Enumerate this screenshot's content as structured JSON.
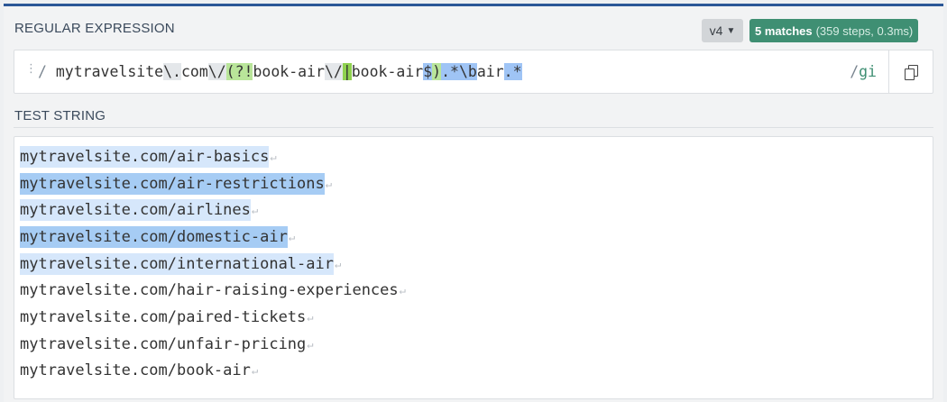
{
  "regex_section": {
    "title": "REGULAR EXPRESSION",
    "flavor": "v4",
    "match_count": "5 matches",
    "match_details": "(359 steps, 0.3ms)",
    "delimiter_open": "/",
    "tokens": [
      {
        "text": " mytravelsite",
        "kind": "plain"
      },
      {
        "text": "\\.",
        "kind": "esc"
      },
      {
        "text": "com",
        "kind": "plain"
      },
      {
        "text": "\\/",
        "kind": "esc"
      },
      {
        "text": "(?!",
        "kind": "grp"
      },
      {
        "text": "book-air",
        "kind": "plain"
      },
      {
        "text": "\\/",
        "kind": "esc"
      },
      {
        "text": "|",
        "kind": "alt"
      },
      {
        "text": "book-air",
        "kind": "plain"
      },
      {
        "text": "$",
        "kind": "anc"
      },
      {
        "text": ")",
        "kind": "grp"
      },
      {
        "text": ".*",
        "kind": "qnt"
      },
      {
        "text": "\\b",
        "kind": "anc"
      },
      {
        "text": "air",
        "kind": "plain"
      },
      {
        "text": ".*",
        "kind": "qnt"
      }
    ],
    "delimiter_close": "/",
    "flags": "gi"
  },
  "test_section": {
    "title": "TEST STRING",
    "lines": [
      {
        "text": "mytravelsite.com/air-basics",
        "match": "light"
      },
      {
        "text": "mytravelsite.com/air-restrictions",
        "match": "dark"
      },
      {
        "text": "mytravelsite.com/airlines",
        "match": "light"
      },
      {
        "text": "mytravelsite.com/domestic-air",
        "match": "dark"
      },
      {
        "text": "mytravelsite.com/international-air",
        "match": "light"
      },
      {
        "text": "mytravelsite.com/hair-raising-experiences",
        "match": "none"
      },
      {
        "text": "mytravelsite.com/paired-tickets",
        "match": "none"
      },
      {
        "text": "mytravelsite.com/unfair-pricing",
        "match": "none"
      },
      {
        "text": "mytravelsite.com/book-air",
        "match": "none"
      }
    ],
    "newline_glyph": "↵"
  },
  "icons": {
    "drag": "drag-handle-icon",
    "copy": "copy-icon",
    "dropdown": "chevron-down-icon"
  },
  "colors": {
    "accent": "#2b5797",
    "match_badge": "#3f8f73",
    "match_light": "#d6e7fb",
    "match_dark": "#a6ccf4"
  }
}
